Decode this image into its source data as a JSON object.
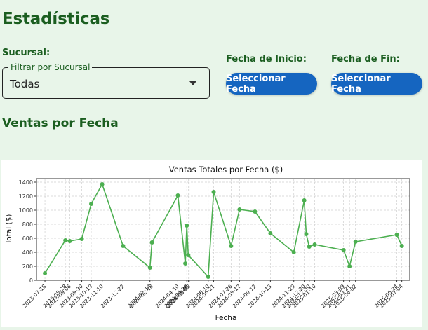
{
  "page": {
    "title": "Estadísticas",
    "section_title": "Ventas por Fecha"
  },
  "filters": {
    "branch_label": "Sucursal:",
    "branch_select_legend": "Filtrar por Sucursal",
    "branch_select_value": "Todas",
    "start_label": "Fecha de Inicio:",
    "start_button": "Seleccionar Fecha",
    "end_label": "Fecha de Fin:",
    "end_button": "Seleccionar Fecha"
  },
  "colors": {
    "accent": "#1565c0",
    "title": "#1b5e20",
    "background": "#e8f5e9",
    "series": "#4caf50"
  },
  "chart_data": {
    "type": "line",
    "title": "Ventas Totales por Fecha ($)",
    "xlabel": "Fecha",
    "ylabel": "Total ($)",
    "ylim": [
      0,
      1450
    ],
    "yticks": [
      0,
      200,
      400,
      600,
      800,
      1000,
      1200,
      1400
    ],
    "xlim": [
      "2023-07-01",
      "2025-07-20"
    ],
    "grid": true,
    "xtick_labels": [
      "2023-07-18",
      "2023-08-28",
      "2023-09-06",
      "2023-09-30",
      "2023-10-19",
      "2023-11-10",
      "2023-12-22",
      "2024-02-14",
      "2024-02-18",
      "2024-04-10",
      "2024-04-28",
      "2024-05-01",
      "2024-05-03",
      "2024-06-10",
      "2024-06-21",
      "2024-07-26",
      "2024-08-12",
      "2024-09-12",
      "2024-10-13",
      "2024-11-29",
      "2024-12-20",
      "2024-12-30",
      "2025-01-10",
      "2025-03-09",
      "2025-03-21",
      "2025-04-02",
      "2025-06-24",
      "2025-07-04"
    ],
    "series": [
      {
        "x": [
          "2023-07-18",
          "2023-08-28",
          "2023-09-06",
          "2023-09-30",
          "2023-10-19",
          "2023-11-10",
          "2023-12-22",
          "2024-02-14",
          "2024-02-18",
          "2024-04-10",
          "2024-04-25",
          "2024-04-28",
          "2024-05-01",
          "2024-06-10",
          "2024-06-21",
          "2024-07-26",
          "2024-08-12",
          "2024-09-12",
          "2024-10-13",
          "2024-11-29",
          "2024-12-20",
          "2024-12-24",
          "2024-12-30",
          "2025-01-10",
          "2025-03-09",
          "2025-03-21",
          "2025-04-02",
          "2025-06-24",
          "2025-07-04"
        ],
        "y": [
          100,
          570,
          560,
          590,
          1090,
          1370,
          490,
          180,
          540,
          1210,
          240,
          780,
          360,
          50,
          1260,
          490,
          1010,
          980,
          670,
          400,
          1140,
          660,
          480,
          510,
          430,
          200,
          550,
          650,
          490
        ]
      }
    ]
  }
}
